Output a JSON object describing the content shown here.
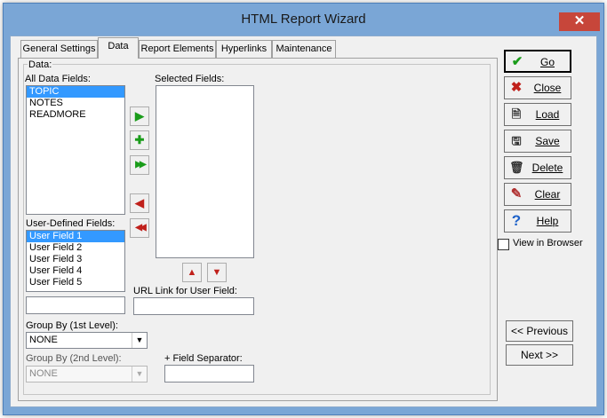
{
  "window": {
    "title": "HTML Report Wizard",
    "close_glyph": "✕"
  },
  "tabs": [
    "General Settings",
    "Data",
    "Report Elements",
    "Hyperlinks",
    "Maintenance"
  ],
  "active_tab": "Data",
  "data_group": {
    "label": "Data:",
    "all_fields_label": "All Data Fields:",
    "all_fields": [
      "TOPIC",
      "NOTES",
      "READMORE"
    ],
    "all_fields_selected": "TOPIC",
    "selected_fields_label": "Selected Fields:",
    "selected_fields": [],
    "user_defined_label": "User-Defined Fields:",
    "user_defined": [
      "User Field 1",
      "User Field 2",
      "User Field 3",
      "User Field 4",
      "User Field 5"
    ],
    "user_defined_selected": "User Field 1",
    "user_field_value": "",
    "url_link_label": "URL Link for User Field:",
    "url_link_value": "",
    "group_by_1_label": "Group By (1st Level):",
    "group_by_1_value": "NONE",
    "group_by_2_label": "Group By (2nd Level):",
    "group_by_2_value": "NONE",
    "field_separator_label": "+ Field Separator:",
    "field_separator_value": ""
  },
  "shuttle_buttons": {
    "add_glyph": "▶",
    "add_all_plus_glyph": "✚",
    "add_all_glyph": "▶▶",
    "remove_glyph": "◀",
    "remove_all_glyph": "◀◀",
    "move_up_glyph": "▲",
    "move_down_glyph": "▼"
  },
  "commands": [
    {
      "label": "Go",
      "icon": "check-icon",
      "glyph": "✔",
      "color": "#1a9c1a"
    },
    {
      "label": "Close",
      "icon": "x-icon",
      "glyph": "✖",
      "color": "#c0201b"
    },
    {
      "label": "Load",
      "icon": "document-icon",
      "glyph": "🗎",
      "color": "#333333"
    },
    {
      "label": "Save",
      "icon": "save-document-icon",
      "glyph": "🖫",
      "color": "#333333"
    },
    {
      "label": "Delete",
      "icon": "trash-icon",
      "glyph": "🗑",
      "color": "#333333"
    },
    {
      "label": "Clear",
      "icon": "broom-icon",
      "glyph": "✎",
      "color": "#b03030"
    },
    {
      "label": "Help",
      "icon": "question-icon",
      "glyph": "?",
      "color": "#1e62c9"
    }
  ],
  "view_in_browser": {
    "label": "View in Browser",
    "checked": false
  },
  "nav": {
    "previous": "<< Previous",
    "next": "Next >>"
  },
  "colors": {
    "selection": "#3399ff",
    "frame": "#7aa6d6",
    "close_button": "#c7463a"
  }
}
